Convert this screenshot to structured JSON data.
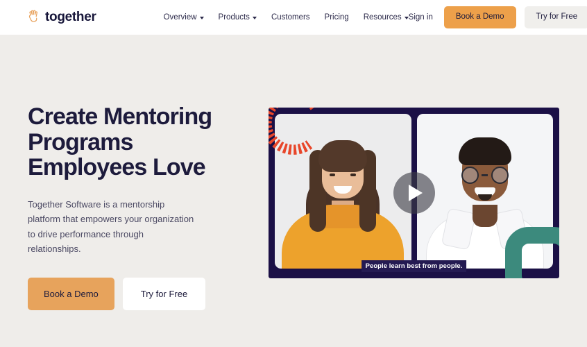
{
  "header": {
    "brand": {
      "name": "together",
      "icon": "waving-hand-icon"
    },
    "nav": [
      {
        "label": "Overview",
        "has_dropdown": true
      },
      {
        "label": "Products",
        "has_dropdown": true
      },
      {
        "label": "Customers",
        "has_dropdown": false
      },
      {
        "label": "Pricing",
        "has_dropdown": false
      },
      {
        "label": "Resources",
        "has_dropdown": true
      }
    ],
    "sign_in_label": "Sign in",
    "book_demo_label": "Book a Demo",
    "try_free_label": "Try for Free"
  },
  "hero": {
    "title": "Create Mentoring Programs Employees Love",
    "subtitle": "Together Software is a mentorship platform that empowers your organization to drive performance through relationships.",
    "book_demo_label": "Book a Demo",
    "try_free_label": "Try for Free"
  },
  "video": {
    "caption": "People learn best from people.",
    "play_icon": "play-icon",
    "left_pane_alt": "Smiling woman in orange hoodie",
    "right_pane_alt": "Smiling man with glasses in white shirt"
  },
  "colors": {
    "page_background": "#efedea",
    "header_background": "#ffffff",
    "text_dark": "#1d1b3c",
    "accent_orange": "#e7a35c",
    "nav_button_orange": "#eda04a",
    "video_frame_navy": "#1b1046",
    "decor_red": "#e8462a",
    "decor_teal": "#3c8a7d",
    "caption_navy": "#241a52"
  }
}
